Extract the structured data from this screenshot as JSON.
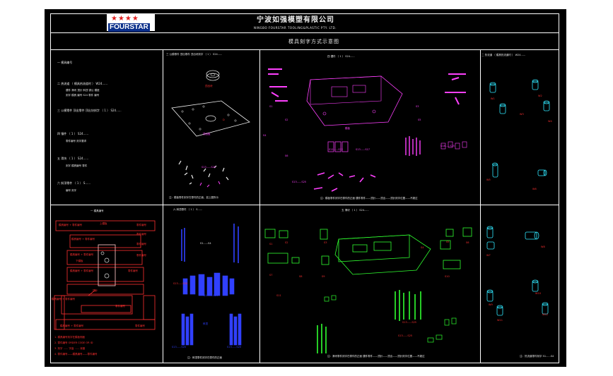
{
  "header": {
    "logo_text": "FOURSTAR",
    "company_cn": "宁波如强模塑有限公司",
    "company_en": "NINGBO FOURSTAR TOOLING&PLASTIC PTY. LTD.",
    "sheet_title": "模具刻字方式示意图"
  },
  "colors": {
    "frame": "#ffffff",
    "accent_red": "#ff3030",
    "magenta": "#ff40ff",
    "cyan": "#30e8ff",
    "green": "#30ff30",
    "blue": "#3040ff"
  },
  "panel1": {
    "lines": [
      "一  模具编号",
      "二  热流道 （ 模具热流道时 ） W24......",
      "三  公模零件   顶出零件   顶出块刻字 （ 1 ） S24......",
      "四  镶件 （ 1 ） S24......",
      "五  滑块 （ 1 ） S24......",
      "六  斜顶零件 （ 1 ）  S......"
    ],
    "notes": [
      "镶件  滑块  顶针  斜顶  铜公  模胚",
      "刻字  模具  编号  S24  零件  编号",
      "零件编号  刻字要求",
      "刻字  模具编号  零件",
      "编号  刻字"
    ]
  },
  "panel2": {
    "title": "三  公模零件   顶出零件   顶出块刻字 （ 1 ） S24......",
    "labels": [
      "顶出块",
      "D",
      "顶出板",
      "S13......S25"
    ],
    "note": "注：模板零件刻字在零件的正面，如上图所示"
  },
  "panel3": {
    "title": "四  镶件 （ 1 ） S24......",
    "labels": [
      "S1",
      "S2",
      "S3",
      "模板",
      "S4",
      "S5",
      "S6",
      "S11......S12",
      "S13......S17",
      "S18......S25",
      "S13......S25"
    ],
    "note": "注：模板零件刻字在零件的正面     镶件零件——顶针——顶出——顶针刻字位置——不超过"
  },
  "panel4": {
    "title": "二  热流道 （ 模具热流道时 ） W24......",
    "labels": [
      "W1",
      "W2",
      "W3",
      "W4",
      "W5",
      "W6"
    ]
  },
  "panel5": {
    "title": "一  模具编号",
    "plates": [
      "模具编号 + 零件编号",
      "模具编号 + 零件编号",
      "模具编号 + 零件编号",
      "模具编号 + 零件编号",
      "模具编号 + 零件编号",
      "模具编号 + 零件编号"
    ],
    "right_labels": [
      "零件编号",
      "零件编号",
      "零件编号",
      "零件编号",
      "零件编号",
      "零件编号",
      "零件编号"
    ],
    "center_labels": [
      "上模板",
      "下模板",
      "顶针"
    ],
    "footnotes": [
      "1. 模具编号刻字在模板侧面",
      "2. 零件编号 ORDER CODE OR ID",
      "3. 刻字 ...... 字高 ...... 深度",
      "4. 零件编号——模具编号——零件编号"
    ]
  },
  "panel6": {
    "title": "六  斜顶零件 （ 1 ）  S......",
    "labels": [
      "S1......S4",
      "S13......S14",
      "S13......S20",
      "S13......S20",
      "斜顶",
      "S13......S20"
    ],
    "note": "注：斜顶零件刻字在零件的正面"
  },
  "panel7": {
    "title": "五  滑块 （ 1 ） S24......",
    "labels": [
      "S1",
      "S2",
      "S3",
      "S4",
      "S5",
      "S6",
      "S7",
      "S8",
      "S9",
      "S10",
      "S11",
      "S13......S25",
      "S13......S25"
    ],
    "note": "注：滑块零件刻字在零件的正面     镶件零件——顶针——顶出——顶针刻字位置——不超过"
  },
  "panel8": {
    "labels": [
      "W7",
      "W8",
      "W9",
      "W10",
      "W11",
      "W12"
    ],
    "note": "注：热流道零件刻字 S1......S4"
  }
}
